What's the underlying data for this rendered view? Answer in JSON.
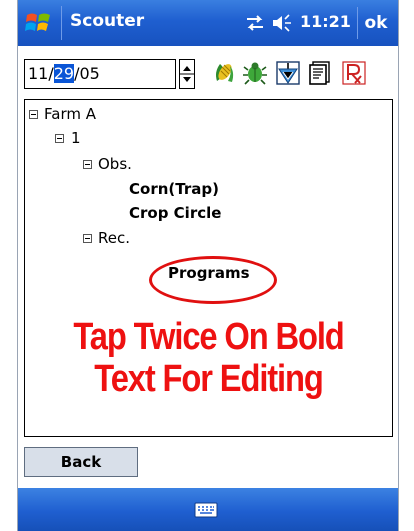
{
  "titlebar": {
    "app_title": "Scouter",
    "clock": "11:21",
    "ok_label": "ok"
  },
  "toolbar": {
    "date_month": "11/",
    "date_day": "29",
    "date_year": "/05",
    "icons": [
      "corn-icon",
      "bug-icon",
      "trap-icon",
      "notes-icon",
      "prescription-icon"
    ]
  },
  "tree": {
    "nodes": [
      {
        "label": "Farm A",
        "expanded": true,
        "bold": false
      },
      {
        "label": "1",
        "expanded": true,
        "bold": false
      },
      {
        "label": "Obs.",
        "expanded": true,
        "bold": false
      },
      {
        "label": "Corn(Trap)",
        "bold": true
      },
      {
        "label": "Crop Circle",
        "bold": true
      },
      {
        "label": "Rec.",
        "expanded": true,
        "bold": false
      },
      {
        "label": "Programs",
        "bold": true,
        "highlighted": true
      }
    ]
  },
  "callout": {
    "line1": "Tap Twice On Bold",
    "line2": "Text For Editing",
    "color": "#ee1111"
  },
  "bottom": {
    "back_label": "Back"
  },
  "colors": {
    "titlebar": "#1f5fd0",
    "selection": "#0a55d6",
    "annotation": "#e01010"
  }
}
